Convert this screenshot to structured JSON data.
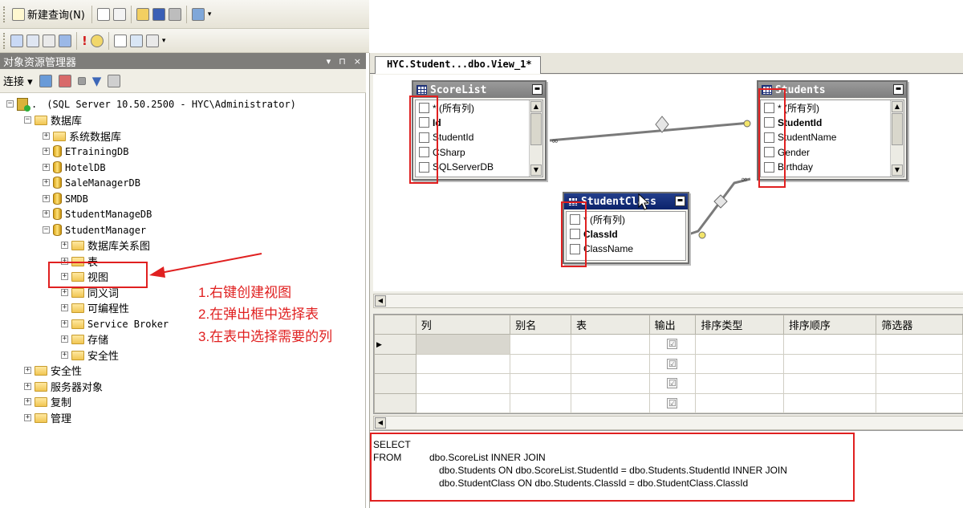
{
  "toolbar": {
    "new_query": "新建查询(N)"
  },
  "object_explorer": {
    "title": "对象资源管理器",
    "pins": [
      "▾",
      "⊓",
      "×"
    ],
    "connect_label": "连接",
    "server": "(SQL Server 10.50.2500 - HYC\\Administrator)",
    "server_prefix": ".",
    "tree": {
      "databases": "数据库",
      "system_db": "系统数据库",
      "etraining": "ETrainingDB",
      "hotel": "HotelDB",
      "salemanager": "SaleManagerDB",
      "smdb": "SMDB",
      "studentmanagedb": "StudentManageDB",
      "studentmanager": "StudentManager",
      "diagrams": "数据库关系图",
      "tables": "表",
      "views": "视图",
      "synonyms": "同义词",
      "programmability": "可编程性",
      "service_broker": "Service Broker",
      "storage": "存储",
      "security_inner": "安全性",
      "security": "安全性",
      "server_objects": "服务器对象",
      "replication": "复制",
      "management": "管理"
    }
  },
  "annotations": [
    "1.右键创建视图",
    "2.在弹出框中选择表",
    "3.在表中选择需要的列"
  ],
  "document": {
    "tab_title": "HYC.Student...dbo.View_1*",
    "tables": {
      "scorelist": {
        "name": "ScoreList",
        "columns": [
          "* (所有列)",
          "Id",
          "StudentId",
          "CSharp",
          "SQLServerDB"
        ]
      },
      "students": {
        "name": "Students",
        "columns": [
          "* (所有列)",
          "StudentId",
          "StudentName",
          "Gender",
          "Birthday"
        ]
      },
      "studentclass": {
        "name": "StudentClass",
        "columns": [
          "* (所有列)",
          "ClassId",
          "ClassName"
        ]
      }
    },
    "grid_headers": [
      "列",
      "别名",
      "表",
      "输出",
      "排序类型",
      "排序顺序",
      "筛选器"
    ],
    "output_check": "☑",
    "sql": {
      "select": "SELECT",
      "from": "FROM",
      "line1": "dbo.ScoreList INNER JOIN",
      "line2": "dbo.Students ON dbo.ScoreList.StudentId = dbo.Students.StudentId INNER JOIN",
      "line3": "dbo.StudentClass ON dbo.Students.ClassId = dbo.StudentClass.ClassId"
    }
  },
  "colors": {
    "annotation": "#e02020",
    "title_active": "#0b236b"
  }
}
